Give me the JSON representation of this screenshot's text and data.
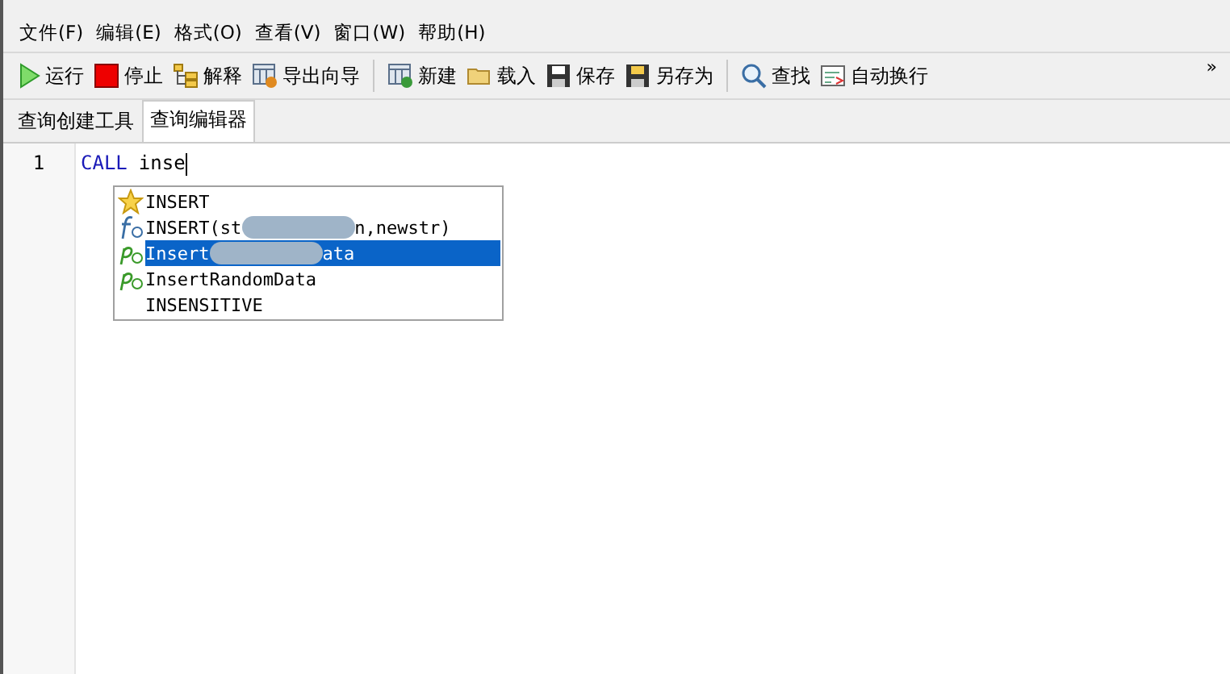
{
  "menu": [
    {
      "label": "文件(F)"
    },
    {
      "label": "编辑(E)"
    },
    {
      "label": "格式(O)"
    },
    {
      "label": "查看(V)"
    },
    {
      "label": "窗口(W)"
    },
    {
      "label": "帮助(H)"
    }
  ],
  "toolbar": [
    {
      "kind": "run",
      "label": "运行"
    },
    {
      "kind": "stop",
      "label": "停止"
    },
    {
      "kind": "explain",
      "label": "解释"
    },
    {
      "kind": "export",
      "label": "导出向导"
    },
    {
      "kind": "sep"
    },
    {
      "kind": "new",
      "label": "新建"
    },
    {
      "kind": "open",
      "label": "载入"
    },
    {
      "kind": "save",
      "label": "保存"
    },
    {
      "kind": "saveas",
      "label": "另存为"
    },
    {
      "kind": "sep"
    },
    {
      "kind": "find",
      "label": "查找"
    },
    {
      "kind": "wrap",
      "label": "自动换行"
    }
  ],
  "overflow": "»",
  "tabs": [
    {
      "label": "查询创建工具",
      "selected": false
    },
    {
      "label": "查询编辑器",
      "selected": true
    }
  ],
  "editor": {
    "line_number": "1",
    "keyword": "CALL",
    "typed": "inse"
  },
  "completions": [
    {
      "kind": "keyword",
      "text": "INSERT",
      "selected": false
    },
    {
      "kind": "function",
      "text": "INSERT(st",
      "text_after": "n,newstr)",
      "selected": false
    },
    {
      "kind": "procedure",
      "text": "Insert",
      "text_after": "ata",
      "selected": true
    },
    {
      "kind": "procedure",
      "text": "InsertRandomData",
      "selected": false
    },
    {
      "kind": "plain",
      "text": "INSENSITIVE",
      "selected": false
    }
  ]
}
